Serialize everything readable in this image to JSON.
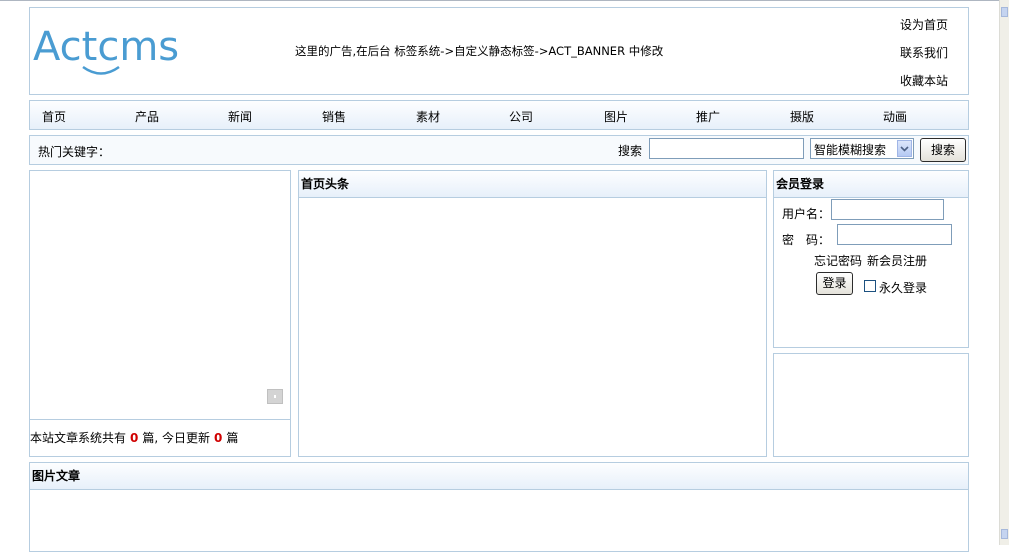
{
  "header": {
    "logo_text": "Actcms",
    "ad_text": "这里的广告,在后台 标签系统->自定义静态标签->ACT_BANNER 中修改",
    "links": [
      "设为首页",
      "联系我们",
      "收藏本站"
    ]
  },
  "nav": {
    "items": [
      "首页",
      "产品",
      "新闻",
      "销售",
      "素材",
      "公司",
      "图片",
      "推广",
      "摄版",
      "动画"
    ]
  },
  "search": {
    "hot_keywords_label": "热门关键字：",
    "label": "搜索",
    "input_value": "",
    "mode_selected": "智能模糊搜索",
    "button_label": "搜索"
  },
  "stats": {
    "prefix": "本站文章系统共有",
    "total": "0",
    "mid": "篇,  今日更新",
    "today": "0",
    "suffix": "篇"
  },
  "headline": {
    "title": "首页头条"
  },
  "login": {
    "title": "会员登录",
    "username_label": "用户名：",
    "password_label": "密　码：",
    "forgot_link": "忘记密码",
    "register_link": "新会员注册",
    "login_button": "登录",
    "remember_label": "永久登录"
  },
  "photo_articles": {
    "title": "图片文章"
  },
  "colors": {
    "border": "#b6cde0",
    "header_gradient_end": "#e7f0fa",
    "highlight_number": "#d00000"
  }
}
